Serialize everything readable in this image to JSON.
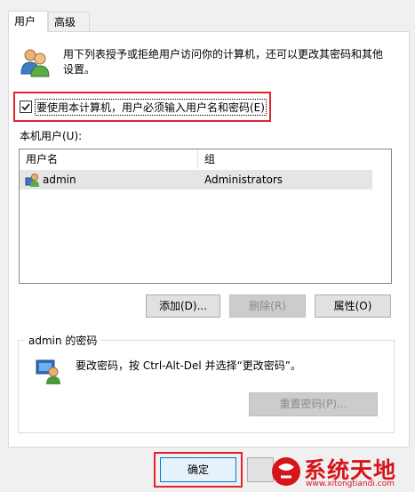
{
  "tabs": [
    {
      "label": "用户"
    },
    {
      "label": "高级"
    }
  ],
  "intro_text": "用下列表授予或拒绝用户访问你的计算机，还可以更改其密码和其他设置。",
  "must_enter_checkbox": {
    "label": "要使用本计算机，用户必须输入用户名和密码(E)",
    "checked": true
  },
  "users_label": "本机用户(U):",
  "list": {
    "columns": [
      "用户名",
      "组"
    ],
    "rows": [
      {
        "name": "admin",
        "group": "Administrators"
      }
    ]
  },
  "buttons": {
    "add": "添加(D)...",
    "remove": "删除(R)",
    "properties": "属性(O)"
  },
  "password_group": {
    "title": "admin 的密码",
    "text": "要改密码，按 Ctrl-Alt-Del 并选择“更改密码”。",
    "reset_button": "重置密码(P)..."
  },
  "dialog_buttons": {
    "ok": "确定"
  },
  "watermark": {
    "brand": "系统天地",
    "url": "www.xitongtiandi.com"
  },
  "colors": {
    "highlight_border": "#e2232b",
    "watermark_red": "#d7141a"
  }
}
